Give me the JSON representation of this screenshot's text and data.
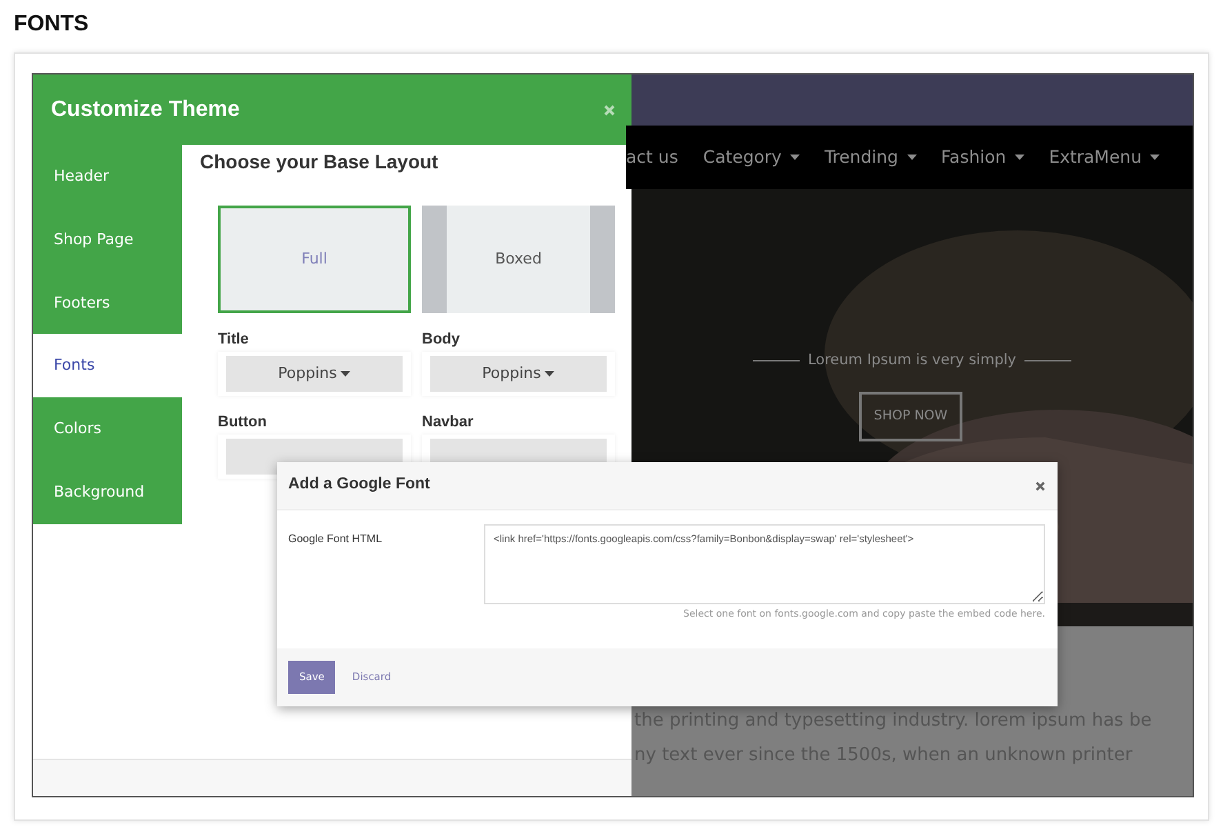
{
  "heading": "FONTS",
  "website": {
    "nav_items": [
      {
        "label": "act us",
        "dropdown": false
      },
      {
        "label": "Category",
        "dropdown": true
      },
      {
        "label": "Trending",
        "dropdown": true
      },
      {
        "label": "Fashion",
        "dropdown": true
      },
      {
        "label": "ExtraMenu",
        "dropdown": true
      }
    ],
    "hero": {
      "tagline": "Loreum Ipsum is very simply",
      "button": "SHOP NOW"
    },
    "body_lines": [
      "the printing and typesetting industry. lorem ipsum has be",
      "ny text ever since the 1500s, when an unknown printer"
    ]
  },
  "customizer": {
    "title": "Customize Theme",
    "sections": [
      {
        "label": "Header",
        "selected": false
      },
      {
        "label": "Shop Page",
        "selected": false
      },
      {
        "label": "Footers",
        "selected": false
      },
      {
        "label": "Fonts",
        "selected": true
      },
      {
        "label": "Colors",
        "selected": false
      },
      {
        "label": "Background",
        "selected": false
      }
    ],
    "heading": "Choose your Base Layout",
    "layouts": [
      {
        "label": "Full",
        "kind": "full",
        "selected": true
      },
      {
        "label": "Boxed",
        "kind": "boxed",
        "selected": false
      }
    ],
    "fonts": [
      {
        "label": "Title",
        "value": "Poppins"
      },
      {
        "label": "Body",
        "value": "Poppins"
      },
      {
        "label": "Button"
      },
      {
        "label": "Navbar"
      }
    ]
  },
  "modal": {
    "title": "Add a Google Font",
    "field_label": "Google Font HTML",
    "field_value": "<link href='https://fonts.googleapis.com/css?family=Bonbon&display=swap' rel='stylesheet'>",
    "help_before": "Select one font on",
    "help_link": "fonts.google.com",
    "help_after": "and copy paste the embed code here.",
    "buttons": [
      {
        "label": "Save",
        "kind": "primary"
      },
      {
        "label": "Discard",
        "kind": "link"
      }
    ]
  }
}
